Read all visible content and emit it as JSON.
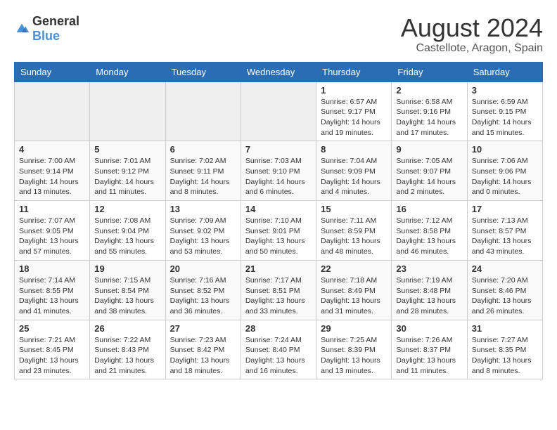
{
  "logo": {
    "general": "General",
    "blue": "Blue"
  },
  "title": "August 2024",
  "subtitle": "Castellote, Aragon, Spain",
  "weekdays": [
    "Sunday",
    "Monday",
    "Tuesday",
    "Wednesday",
    "Thursday",
    "Friday",
    "Saturday"
  ],
  "weeks": [
    [
      {
        "day": "",
        "info": ""
      },
      {
        "day": "",
        "info": ""
      },
      {
        "day": "",
        "info": ""
      },
      {
        "day": "",
        "info": ""
      },
      {
        "day": "1",
        "info": "Sunrise: 6:57 AM\nSunset: 9:17 PM\nDaylight: 14 hours and 19 minutes."
      },
      {
        "day": "2",
        "info": "Sunrise: 6:58 AM\nSunset: 9:16 PM\nDaylight: 14 hours and 17 minutes."
      },
      {
        "day": "3",
        "info": "Sunrise: 6:59 AM\nSunset: 9:15 PM\nDaylight: 14 hours and 15 minutes."
      }
    ],
    [
      {
        "day": "4",
        "info": "Sunrise: 7:00 AM\nSunset: 9:14 PM\nDaylight: 14 hours and 13 minutes."
      },
      {
        "day": "5",
        "info": "Sunrise: 7:01 AM\nSunset: 9:12 PM\nDaylight: 14 hours and 11 minutes."
      },
      {
        "day": "6",
        "info": "Sunrise: 7:02 AM\nSunset: 9:11 PM\nDaylight: 14 hours and 8 minutes."
      },
      {
        "day": "7",
        "info": "Sunrise: 7:03 AM\nSunset: 9:10 PM\nDaylight: 14 hours and 6 minutes."
      },
      {
        "day": "8",
        "info": "Sunrise: 7:04 AM\nSunset: 9:09 PM\nDaylight: 14 hours and 4 minutes."
      },
      {
        "day": "9",
        "info": "Sunrise: 7:05 AM\nSunset: 9:07 PM\nDaylight: 14 hours and 2 minutes."
      },
      {
        "day": "10",
        "info": "Sunrise: 7:06 AM\nSunset: 9:06 PM\nDaylight: 14 hours and 0 minutes."
      }
    ],
    [
      {
        "day": "11",
        "info": "Sunrise: 7:07 AM\nSunset: 9:05 PM\nDaylight: 13 hours and 57 minutes."
      },
      {
        "day": "12",
        "info": "Sunrise: 7:08 AM\nSunset: 9:04 PM\nDaylight: 13 hours and 55 minutes."
      },
      {
        "day": "13",
        "info": "Sunrise: 7:09 AM\nSunset: 9:02 PM\nDaylight: 13 hours and 53 minutes."
      },
      {
        "day": "14",
        "info": "Sunrise: 7:10 AM\nSunset: 9:01 PM\nDaylight: 13 hours and 50 minutes."
      },
      {
        "day": "15",
        "info": "Sunrise: 7:11 AM\nSunset: 8:59 PM\nDaylight: 13 hours and 48 minutes."
      },
      {
        "day": "16",
        "info": "Sunrise: 7:12 AM\nSunset: 8:58 PM\nDaylight: 13 hours and 46 minutes."
      },
      {
        "day": "17",
        "info": "Sunrise: 7:13 AM\nSunset: 8:57 PM\nDaylight: 13 hours and 43 minutes."
      }
    ],
    [
      {
        "day": "18",
        "info": "Sunrise: 7:14 AM\nSunset: 8:55 PM\nDaylight: 13 hours and 41 minutes."
      },
      {
        "day": "19",
        "info": "Sunrise: 7:15 AM\nSunset: 8:54 PM\nDaylight: 13 hours and 38 minutes."
      },
      {
        "day": "20",
        "info": "Sunrise: 7:16 AM\nSunset: 8:52 PM\nDaylight: 13 hours and 36 minutes."
      },
      {
        "day": "21",
        "info": "Sunrise: 7:17 AM\nSunset: 8:51 PM\nDaylight: 13 hours and 33 minutes."
      },
      {
        "day": "22",
        "info": "Sunrise: 7:18 AM\nSunset: 8:49 PM\nDaylight: 13 hours and 31 minutes."
      },
      {
        "day": "23",
        "info": "Sunrise: 7:19 AM\nSunset: 8:48 PM\nDaylight: 13 hours and 28 minutes."
      },
      {
        "day": "24",
        "info": "Sunrise: 7:20 AM\nSunset: 8:46 PM\nDaylight: 13 hours and 26 minutes."
      }
    ],
    [
      {
        "day": "25",
        "info": "Sunrise: 7:21 AM\nSunset: 8:45 PM\nDaylight: 13 hours and 23 minutes."
      },
      {
        "day": "26",
        "info": "Sunrise: 7:22 AM\nSunset: 8:43 PM\nDaylight: 13 hours and 21 minutes."
      },
      {
        "day": "27",
        "info": "Sunrise: 7:23 AM\nSunset: 8:42 PM\nDaylight: 13 hours and 18 minutes."
      },
      {
        "day": "28",
        "info": "Sunrise: 7:24 AM\nSunset: 8:40 PM\nDaylight: 13 hours and 16 minutes."
      },
      {
        "day": "29",
        "info": "Sunrise: 7:25 AM\nSunset: 8:39 PM\nDaylight: 13 hours and 13 minutes."
      },
      {
        "day": "30",
        "info": "Sunrise: 7:26 AM\nSunset: 8:37 PM\nDaylight: 13 hours and 11 minutes."
      },
      {
        "day": "31",
        "info": "Sunrise: 7:27 AM\nSunset: 8:35 PM\nDaylight: 13 hours and 8 minutes."
      }
    ]
  ]
}
